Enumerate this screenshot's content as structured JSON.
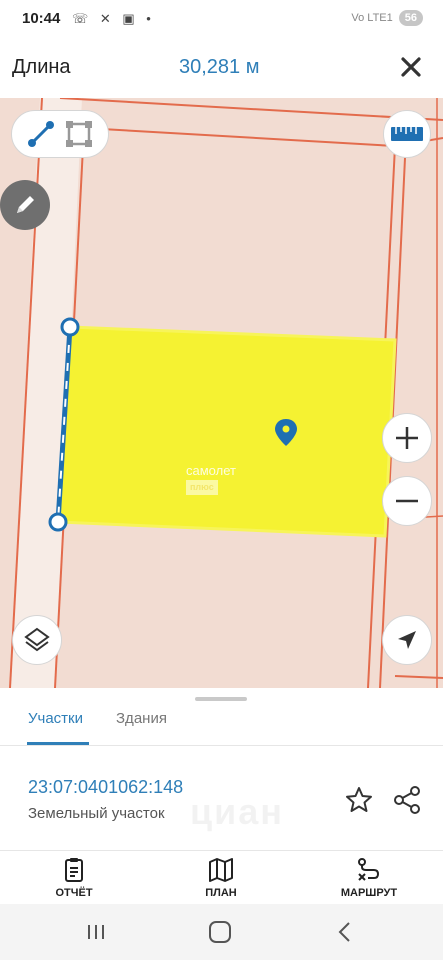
{
  "status_bar": {
    "time": "10:44",
    "left_icons": [
      "whatsapp-icon",
      "cross-signal-icon",
      "screen-icon",
      "dot-icon"
    ],
    "network": "Vo LTE1",
    "battery": "56"
  },
  "measure": {
    "label": "Длина",
    "value": "30,281 м"
  },
  "map": {
    "watermark_line1": "самолет",
    "watermark_line2": "плюс",
    "parcel_fill": "#f5f232",
    "measure_line_color": "#1f6fb2",
    "boundary_color": "#e36b4c"
  },
  "sheet": {
    "tabs": [
      {
        "label": "Участки",
        "active": true
      },
      {
        "label": "Здания",
        "active": false
      }
    ],
    "cadastral_number": "23:07:0401062:148",
    "object_type": "Земельный участок",
    "watermark": "циан"
  },
  "actions": [
    {
      "label": "ОТЧЁТ",
      "icon": "report-icon"
    },
    {
      "label": "ПЛАН",
      "icon": "map-plan-icon"
    },
    {
      "label": "МАРШРУТ",
      "icon": "route-icon"
    }
  ],
  "colors": {
    "accent": "#2f7fb8",
    "map_background": "#f2dcd2"
  }
}
